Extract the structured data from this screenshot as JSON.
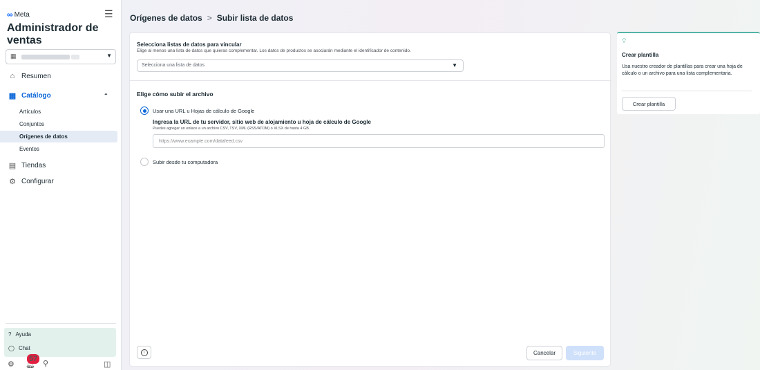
{
  "sidebar": {
    "brand": "Meta",
    "app_title": "Administrador de ventas",
    "nav": {
      "summary": "Resumen",
      "catalog": "Catálogo",
      "catalog_sub": [
        "Artículos",
        "Conjuntos",
        "Orígenes de datos",
        "Eventos"
      ],
      "shops": "Tiendas",
      "settings": "Configurar"
    },
    "help": "Ayuda",
    "chat": "Chat",
    "notification_count": "57"
  },
  "header": {
    "crumb1": "Orígenes de datos",
    "separator": ">",
    "crumb2": "Subir lista de datos"
  },
  "main": {
    "section1": {
      "title": "Selecciona listas de datos para vincular",
      "subtitle": "Elige al menos una lista de datos que quieras complementar. Los datos de productos se asociarán mediante el identificador de contenido.",
      "select_placeholder": "Selecciona una lista de datos"
    },
    "section2": {
      "title": "Elige cómo subir el archivo",
      "option_url": "Usar una URL u Hojas de cálculo de Google",
      "option_url_selected": true,
      "url_title": "Ingresa la URL de tu servidor, sitio web de alojamiento u hoja de cálculo de Google",
      "url_help": "Puedes agregar un enlace a un archivo CSV, TSV, XML (RSS/ATOM) o XLSX de hasta 4 GB.",
      "url_placeholder": "https://www.example.com/datafeed.csv",
      "option_upload": "Subir desde tu computadora"
    },
    "footer": {
      "cancel": "Cancelar",
      "next": "Siguiente"
    }
  },
  "template_card": {
    "title": "Crear plantilla",
    "description": "Usa nuestro creador de plantillas para crear una hoja de cálculo o un archivo para una lista complementaria.",
    "button": "Crear plantilla"
  },
  "colors": {
    "accent": "#0a66d8",
    "card_accent": "#53b4a6",
    "badge": "#e41e3f",
    "disabled_button": "#cfe0fa"
  }
}
